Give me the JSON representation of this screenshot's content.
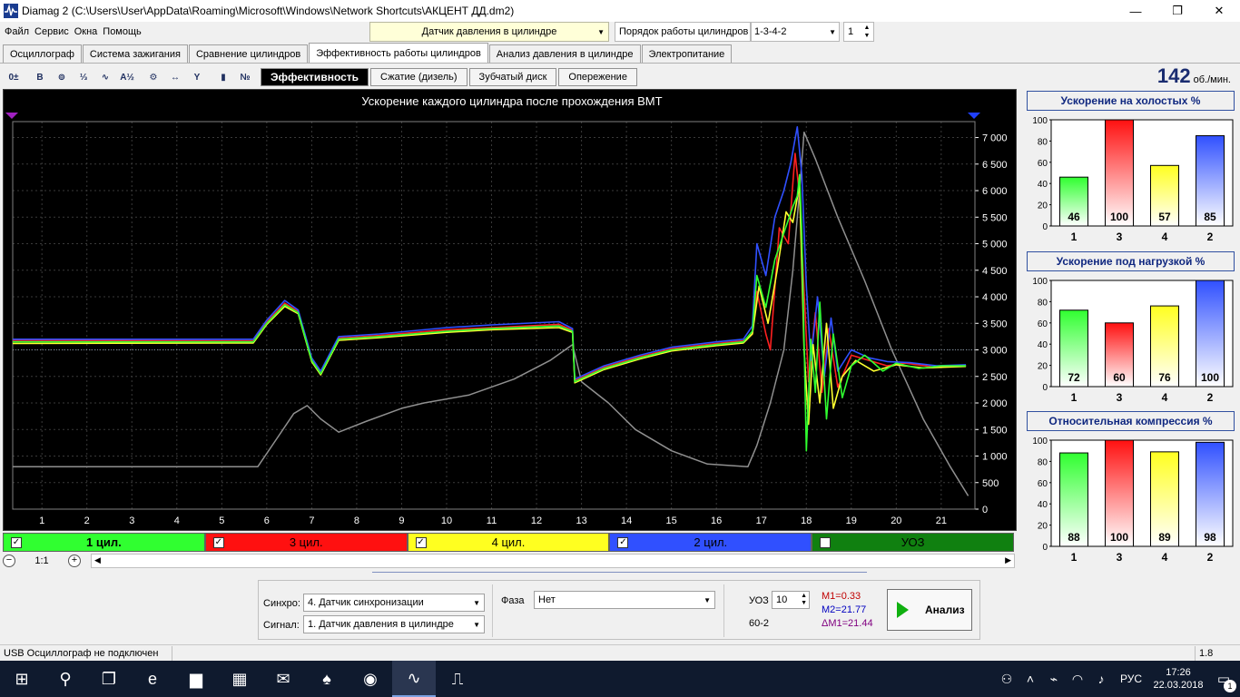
{
  "window": {
    "title": "Diamag 2 (C:\\Users\\User\\AppData\\Roaming\\Microsoft\\Windows\\Network Shortcuts\\АКЦЕНТ ДД.dm2)",
    "minimize": "—",
    "maximize": "❐",
    "close": "✕"
  },
  "menu": [
    "Файл",
    "Сервис",
    "Окна",
    "Помощь"
  ],
  "sensor": {
    "value": "Датчик давления в цилиндре"
  },
  "firing_order": {
    "label": "Порядок работы цилиндров",
    "value": "1-3-4-2",
    "spin": "1"
  },
  "tabs": [
    {
      "label": "Осциллограф",
      "active": false
    },
    {
      "label": "Система зажигания",
      "active": false
    },
    {
      "label": "Сравнение цилиндров",
      "active": false
    },
    {
      "label": "Эффективность работы цилиндров",
      "active": true
    },
    {
      "label": "Анализ давления в цилиндре",
      "active": false
    },
    {
      "label": "Электропитание",
      "active": false
    }
  ],
  "toolbar": {
    "icons": [
      {
        "name": "zero-offset-icon",
        "glyph": "0±"
      },
      {
        "name": "bold-icon",
        "glyph": "B"
      },
      {
        "name": "rpm-icon",
        "glyph": "⊚"
      },
      {
        "name": "cylinder-order-icon",
        "glyph": "⅓"
      },
      {
        "name": "curve-icon",
        "glyph": "∿"
      },
      {
        "name": "algorithm-icon",
        "glyph": "A½"
      },
      {
        "name": "engine-icon",
        "glyph": "⚙"
      },
      {
        "name": "range-icon",
        "glyph": "↔"
      },
      {
        "name": "filter-icon",
        "glyph": "Y"
      },
      {
        "name": "bar-chart-icon",
        "glyph": "▮"
      },
      {
        "name": "numbers-icon",
        "glyph": "№"
      }
    ],
    "subtabs": [
      {
        "label": "Эффективность",
        "active": true
      },
      {
        "label": "Сжатие (дизель)",
        "active": false
      },
      {
        "label": "Зубчатый диск",
        "active": false
      },
      {
        "label": "Опережение",
        "active": false
      }
    ]
  },
  "rpm": {
    "value": "142",
    "unit": "об./мин."
  },
  "chart_data": {
    "type": "line",
    "title": "Ускорение каждого цилиндра после прохождения ВМТ",
    "xlim": [
      0.35,
      21.75
    ],
    "ylim": [
      0,
      7300
    ],
    "x_ticks": [
      "1",
      "2",
      "3",
      "4",
      "5",
      "6",
      "7",
      "8",
      "9",
      "10",
      "11",
      "12",
      "13",
      "14",
      "15",
      "16",
      "17",
      "18",
      "19",
      "20",
      "21"
    ],
    "y_ticks": [
      "0",
      "500",
      "1 000",
      "1 500",
      "2 000",
      "2 500",
      "3 000",
      "3 500",
      "4 000",
      "4 500",
      "5 000",
      "5 500",
      "6 000",
      "6 500",
      "7 000"
    ],
    "series": [
      {
        "name": "1 цил.",
        "color": "#30ff30",
        "points": [
          [
            0.35,
            3150
          ],
          [
            5.7,
            3150
          ],
          [
            6.0,
            3500
          ],
          [
            6.4,
            3850
          ],
          [
            6.7,
            3700
          ],
          [
            7.0,
            2800
          ],
          [
            7.2,
            2550
          ],
          [
            7.6,
            3200
          ],
          [
            8.5,
            3250
          ],
          [
            10.0,
            3350
          ],
          [
            11.0,
            3400
          ],
          [
            12.5,
            3450
          ],
          [
            12.8,
            3350
          ],
          [
            12.85,
            2400
          ],
          [
            13.5,
            2650
          ],
          [
            14.3,
            2850
          ],
          [
            15.0,
            3000
          ],
          [
            16.0,
            3100
          ],
          [
            16.6,
            3150
          ],
          [
            16.8,
            3350
          ],
          [
            16.9,
            4400
          ],
          [
            17.1,
            3800
          ],
          [
            17.3,
            4700
          ],
          [
            17.5,
            5200
          ],
          [
            17.7,
            5700
          ],
          [
            17.8,
            5900
          ],
          [
            17.85,
            6300
          ],
          [
            17.9,
            5200
          ],
          [
            18.0,
            1100
          ],
          [
            18.1,
            3200
          ],
          [
            18.2,
            2200
          ],
          [
            18.3,
            3900
          ],
          [
            18.45,
            1700
          ],
          [
            18.6,
            3300
          ],
          [
            18.8,
            2100
          ],
          [
            19.0,
            2700
          ],
          [
            19.3,
            2900
          ],
          [
            19.7,
            2600
          ],
          [
            20.0,
            2750
          ],
          [
            20.5,
            2650
          ],
          [
            21.0,
            2700
          ],
          [
            21.55,
            2700
          ]
        ]
      },
      {
        "name": "3 цил.",
        "color": "#ff2020",
        "points": [
          [
            0.35,
            3180
          ],
          [
            5.7,
            3170
          ],
          [
            6.0,
            3520
          ],
          [
            6.4,
            3880
          ],
          [
            6.7,
            3720
          ],
          [
            7.0,
            2820
          ],
          [
            7.2,
            2570
          ],
          [
            7.6,
            3220
          ],
          [
            8.5,
            3270
          ],
          [
            10.0,
            3380
          ],
          [
            11.0,
            3420
          ],
          [
            12.5,
            3480
          ],
          [
            12.8,
            3370
          ],
          [
            12.85,
            2420
          ],
          [
            13.5,
            2670
          ],
          [
            14.3,
            2870
          ],
          [
            15.0,
            3020
          ],
          [
            16.0,
            3120
          ],
          [
            16.6,
            3170
          ],
          [
            16.8,
            3300
          ],
          [
            16.9,
            4100
          ],
          [
            17.1,
            3300
          ],
          [
            17.2,
            3000
          ],
          [
            17.4,
            5300
          ],
          [
            17.6,
            5000
          ],
          [
            17.75,
            6700
          ],
          [
            17.85,
            5900
          ],
          [
            17.95,
            4100
          ],
          [
            18.05,
            2400
          ],
          [
            18.2,
            3700
          ],
          [
            18.35,
            2200
          ],
          [
            18.5,
            3400
          ],
          [
            18.7,
            2300
          ],
          [
            19.0,
            2900
          ],
          [
            19.4,
            2800
          ],
          [
            19.8,
            2700
          ],
          [
            20.2,
            2750
          ],
          [
            20.8,
            2680
          ],
          [
            21.55,
            2700
          ]
        ]
      },
      {
        "name": "4 цил.",
        "color": "#ffff30",
        "points": [
          [
            0.35,
            3120
          ],
          [
            5.7,
            3130
          ],
          [
            6.0,
            3480
          ],
          [
            6.4,
            3820
          ],
          [
            6.7,
            3680
          ],
          [
            7.0,
            2780
          ],
          [
            7.2,
            2530
          ],
          [
            7.6,
            3180
          ],
          [
            8.5,
            3230
          ],
          [
            10.0,
            3330
          ],
          [
            11.0,
            3380
          ],
          [
            12.5,
            3420
          ],
          [
            12.8,
            3330
          ],
          [
            12.85,
            2380
          ],
          [
            13.5,
            2630
          ],
          [
            14.3,
            2830
          ],
          [
            15.0,
            2980
          ],
          [
            16.0,
            3080
          ],
          [
            16.6,
            3130
          ],
          [
            16.8,
            3300
          ],
          [
            16.95,
            4200
          ],
          [
            17.15,
            3500
          ],
          [
            17.35,
            4500
          ],
          [
            17.55,
            5600
          ],
          [
            17.7,
            5400
          ],
          [
            17.85,
            6100
          ],
          [
            17.95,
            3000
          ],
          [
            18.05,
            1600
          ],
          [
            18.15,
            3100
          ],
          [
            18.3,
            2000
          ],
          [
            18.45,
            3500
          ],
          [
            18.6,
            1900
          ],
          [
            18.8,
            2500
          ],
          [
            19.1,
            2800
          ],
          [
            19.5,
            2600
          ],
          [
            20.0,
            2720
          ],
          [
            20.6,
            2660
          ],
          [
            21.55,
            2690
          ]
        ]
      },
      {
        "name": "2 цил.",
        "color": "#3050ff",
        "points": [
          [
            0.35,
            3200
          ],
          [
            5.7,
            3200
          ],
          [
            6.0,
            3560
          ],
          [
            6.4,
            3930
          ],
          [
            6.7,
            3750
          ],
          [
            7.0,
            2850
          ],
          [
            7.2,
            2600
          ],
          [
            7.6,
            3250
          ],
          [
            8.5,
            3300
          ],
          [
            10.0,
            3420
          ],
          [
            11.0,
            3470
          ],
          [
            12.5,
            3530
          ],
          [
            12.8,
            3400
          ],
          [
            12.85,
            2450
          ],
          [
            13.5,
            2700
          ],
          [
            14.3,
            2900
          ],
          [
            15.0,
            3050
          ],
          [
            16.0,
            3150
          ],
          [
            16.6,
            3200
          ],
          [
            16.8,
            3450
          ],
          [
            16.9,
            5000
          ],
          [
            17.1,
            4400
          ],
          [
            17.3,
            5500
          ],
          [
            17.5,
            6000
          ],
          [
            17.65,
            6500
          ],
          [
            17.8,
            7200
          ],
          [
            17.9,
            6300
          ],
          [
            18.0,
            4200
          ],
          [
            18.1,
            2800
          ],
          [
            18.25,
            4000
          ],
          [
            18.4,
            2500
          ],
          [
            18.55,
            3600
          ],
          [
            18.7,
            2600
          ],
          [
            19.0,
            3000
          ],
          [
            19.4,
            2850
          ],
          [
            19.8,
            2780
          ],
          [
            20.3,
            2760
          ],
          [
            20.9,
            2700
          ],
          [
            21.55,
            2720
          ]
        ]
      },
      {
        "name": "УОЗ",
        "color": "#909090",
        "points": [
          [
            0.35,
            800
          ],
          [
            5.8,
            800
          ],
          [
            6.2,
            1300
          ],
          [
            6.6,
            1800
          ],
          [
            6.9,
            1950
          ],
          [
            7.2,
            1700
          ],
          [
            7.6,
            1450
          ],
          [
            8.2,
            1650
          ],
          [
            9.0,
            1900
          ],
          [
            9.5,
            2000
          ],
          [
            10.5,
            2150
          ],
          [
            11.5,
            2450
          ],
          [
            12.3,
            2800
          ],
          [
            12.8,
            3100
          ],
          [
            13.0,
            2400
          ],
          [
            13.6,
            2000
          ],
          [
            14.2,
            1500
          ],
          [
            15.0,
            1100
          ],
          [
            15.8,
            850
          ],
          [
            16.7,
            800
          ],
          [
            16.9,
            1200
          ],
          [
            17.2,
            2000
          ],
          [
            17.5,
            3000
          ],
          [
            17.7,
            4500
          ],
          [
            17.85,
            6000
          ],
          [
            17.95,
            7100
          ],
          [
            18.2,
            6600
          ],
          [
            18.7,
            5500
          ],
          [
            19.3,
            4300
          ],
          [
            19.9,
            3000
          ],
          [
            20.6,
            1700
          ],
          [
            21.2,
            800
          ],
          [
            21.6,
            250
          ]
        ]
      }
    ],
    "cursor_markers": {
      "left_color": "#a020c0",
      "right_color": "#2040ff"
    }
  },
  "channels": [
    {
      "label": "1 цил.",
      "checked": true,
      "bg": "#30ff30",
      "fg": "#000",
      "bold": true
    },
    {
      "label": "3 цил.",
      "checked": true,
      "bg": "#ff1010",
      "fg": "#000",
      "bold": false
    },
    {
      "label": "4 цил.",
      "checked": true,
      "bg": "#ffff20",
      "fg": "#000",
      "bold": false
    },
    {
      "label": "2 цил.",
      "checked": true,
      "bg": "#3050ff",
      "fg": "#000",
      "bold": false
    },
    {
      "label": "УОЗ",
      "checked": false,
      "bg": "#108010",
      "fg": "#000",
      "bold": false
    }
  ],
  "zoom": {
    "label": "1:1",
    "minus": "−",
    "plus": "+"
  },
  "bar_charts": [
    {
      "title": "Ускорение на холостых %",
      "categories": [
        "1",
        "3",
        "4",
        "2"
      ],
      "values": [
        46,
        100,
        57,
        85
      ],
      "colors": [
        "#30ff30",
        "#ff1010",
        "#ffff20",
        "#3050ff"
      ],
      "ylim": [
        0,
        100
      ],
      "y_ticks": [
        "0",
        "20",
        "40",
        "60",
        "80",
        "100"
      ]
    },
    {
      "title": "Ускорение под нагрузкой %",
      "categories": [
        "1",
        "3",
        "4",
        "2"
      ],
      "values": [
        72,
        60,
        76,
        100
      ],
      "colors": [
        "#30ff30",
        "#ff1010",
        "#ffff20",
        "#3050ff"
      ],
      "ylim": [
        0,
        100
      ],
      "y_ticks": [
        "0",
        "20",
        "40",
        "60",
        "80",
        "100"
      ]
    },
    {
      "title": "Относительная компрессия %",
      "categories": [
        "1",
        "3",
        "4",
        "2"
      ],
      "values": [
        88,
        100,
        89,
        98
      ],
      "colors": [
        "#30ff30",
        "#ff1010",
        "#ffff20",
        "#3050ff"
      ],
      "ylim": [
        0,
        100
      ],
      "y_ticks": [
        "0",
        "20",
        "40",
        "60",
        "80",
        "100"
      ]
    }
  ],
  "bottom": {
    "sync_label": "Синхро:",
    "sync_value": "4.  Датчик синхронизации",
    "signal_label": "Сигнал:",
    "signal_value": "1.  Датчик давления в цилиндре",
    "phase_label": "Фаза",
    "phase_value": "Нет",
    "uoz_label": "УОЗ",
    "uoz_value": "10",
    "teeth": "60-2",
    "m1": "M1=0.33",
    "m2": "M2=21.77",
    "dm1": "ΔM1=21.44",
    "m1_color": "#c00000",
    "m2_color": "#0000c0",
    "dm1_color": "#800080",
    "analyze_label": "Анализ"
  },
  "status": {
    "left": "USB Осциллограф не подключен",
    "right": "1.8"
  },
  "taskbar": {
    "icons": [
      {
        "name": "start-icon",
        "glyph": "⊞"
      },
      {
        "name": "search-icon",
        "glyph": "⚲"
      },
      {
        "name": "task-view-icon",
        "glyph": "❐"
      },
      {
        "name": "edge-icon",
        "glyph": "e"
      },
      {
        "name": "explorer-icon",
        "glyph": "▆"
      },
      {
        "name": "store-icon",
        "glyph": "▦"
      },
      {
        "name": "mail-icon",
        "glyph": "✉"
      },
      {
        "name": "solitaire-icon",
        "glyph": "♠"
      },
      {
        "name": "chrome-icon",
        "glyph": "◉"
      },
      {
        "name": "diamag-icon",
        "glyph": "∿"
      },
      {
        "name": "oscilloscope-icon",
        "glyph": "⎍"
      }
    ],
    "active_index": 9,
    "tray": {
      "people": "⚇",
      "chevron": "˄",
      "network": "⌁",
      "wifi": "◠",
      "volume": "♪",
      "language": "РУС",
      "time": "17:26",
      "date": "22.03.2018",
      "notifications": "▭",
      "badge": "1"
    }
  }
}
